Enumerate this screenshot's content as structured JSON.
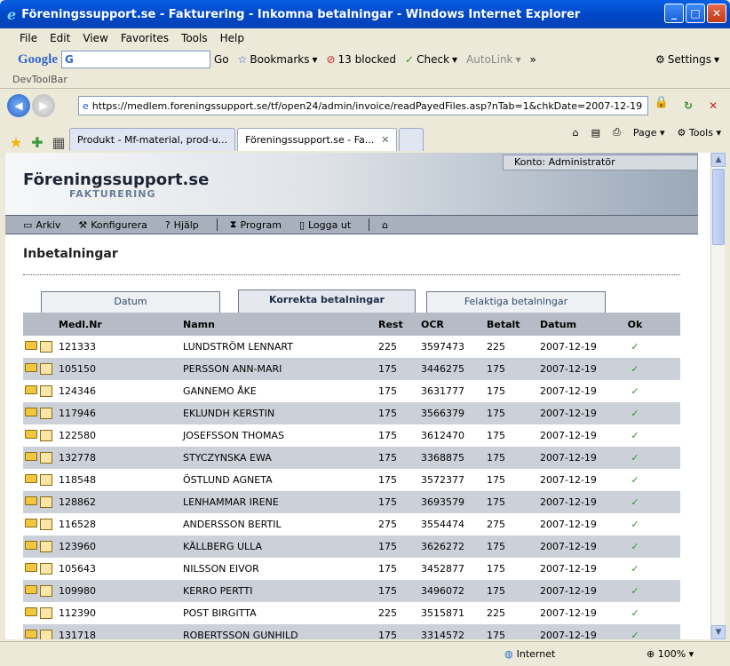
{
  "window": {
    "title": "Föreningssupport.se - Fakturering - Inkomna betalningar - Windows Internet Explorer",
    "minimize": "_",
    "maximize": "□",
    "close": "✕"
  },
  "menu": [
    "File",
    "Edit",
    "View",
    "Favorites",
    "Tools",
    "Help"
  ],
  "googlebar": {
    "logo": "Google",
    "input_value": "G",
    "go": "Go",
    "bookmarks": "Bookmarks",
    "blocked": "13 blocked",
    "check": "Check",
    "autolink": "AutoLink",
    "more": "»",
    "settings": "Settings"
  },
  "devtoolbar": "DevToolBar",
  "address": {
    "url": "https://medlem.foreningssupport.se/tf/open24/admin/invoice/readPayedFiles.asp?nTab=1&chkDate=2007-12-19"
  },
  "browsertabs": [
    {
      "label": "Produkt - Mf-material, prod-u..."
    },
    {
      "label": "Föreningssupport.se - Fa..."
    }
  ],
  "tabtools": {
    "page": "Page",
    "tools": "Tools"
  },
  "app": {
    "konto": "Konto: Administratör",
    "brand": "Föreningssupport.se",
    "brand_sub": "FAKTURERING",
    "nav": {
      "arkiv": "Arkiv",
      "konfigurera": "Konfigurera",
      "hjalp": "Hjälp",
      "program": "Program",
      "logga_ut": "Logga ut"
    },
    "page_title": "Inbetalningar",
    "tabs": [
      "Datum",
      "Korrekta betalningar",
      "Felaktiga betalningar"
    ],
    "columns": [
      "Medl.Nr",
      "Namn",
      "Rest",
      "OCR",
      "Betalt",
      "Datum",
      "Ok"
    ],
    "rows": [
      {
        "nr": "121333",
        "namn": "LUNDSTRÖM LENNART",
        "rest": "225",
        "ocr": "3597473",
        "betalt": "225",
        "datum": "2007-12-19"
      },
      {
        "nr": "105150",
        "namn": "PERSSON ANN-MARI",
        "rest": "175",
        "ocr": "3446275",
        "betalt": "175",
        "datum": "2007-12-19"
      },
      {
        "nr": "124346",
        "namn": "GANNEMO ÅKE",
        "rest": "175",
        "ocr": "3631777",
        "betalt": "175",
        "datum": "2007-12-19"
      },
      {
        "nr": "117946",
        "namn": "EKLUNDH KERSTIN",
        "rest": "175",
        "ocr": "3566379",
        "betalt": "175",
        "datum": "2007-12-19"
      },
      {
        "nr": "122580",
        "namn": "JOSEFSSON THOMAS",
        "rest": "175",
        "ocr": "3612470",
        "betalt": "175",
        "datum": "2007-12-19"
      },
      {
        "nr": "132778",
        "namn": "STYCZYNSKA EWA",
        "rest": "175",
        "ocr": "3368875",
        "betalt": "175",
        "datum": "2007-12-19"
      },
      {
        "nr": "118548",
        "namn": "ÖSTLUND AGNETA",
        "rest": "175",
        "ocr": "3572377",
        "betalt": "175",
        "datum": "2007-12-19"
      },
      {
        "nr": "128862",
        "namn": "LENHAMMAR IRENE",
        "rest": "175",
        "ocr": "3693579",
        "betalt": "175",
        "datum": "2007-12-19"
      },
      {
        "nr": "116528",
        "namn": "ANDERSSON BERTIL",
        "rest": "275",
        "ocr": "3554474",
        "betalt": "275",
        "datum": "2007-12-19"
      },
      {
        "nr": "123960",
        "namn": "KÄLLBERG ULLA",
        "rest": "175",
        "ocr": "3626272",
        "betalt": "175",
        "datum": "2007-12-19"
      },
      {
        "nr": "105643",
        "namn": "NILSSON EIVOR",
        "rest": "175",
        "ocr": "3452877",
        "betalt": "175",
        "datum": "2007-12-19"
      },
      {
        "nr": "109980",
        "namn": "KERRO PERTTI",
        "rest": "175",
        "ocr": "3496072",
        "betalt": "175",
        "datum": "2007-12-19"
      },
      {
        "nr": "112390",
        "namn": "POST BIRGITTA",
        "rest": "225",
        "ocr": "3515871",
        "betalt": "225",
        "datum": "2007-12-19"
      },
      {
        "nr": "131718",
        "namn": "ROBERTSSON GUNHILD",
        "rest": "175",
        "ocr": "3314572",
        "betalt": "175",
        "datum": "2007-12-19"
      }
    ],
    "ok_mark": "✓"
  },
  "status": {
    "zone": "Internet",
    "zoom": "100%"
  }
}
